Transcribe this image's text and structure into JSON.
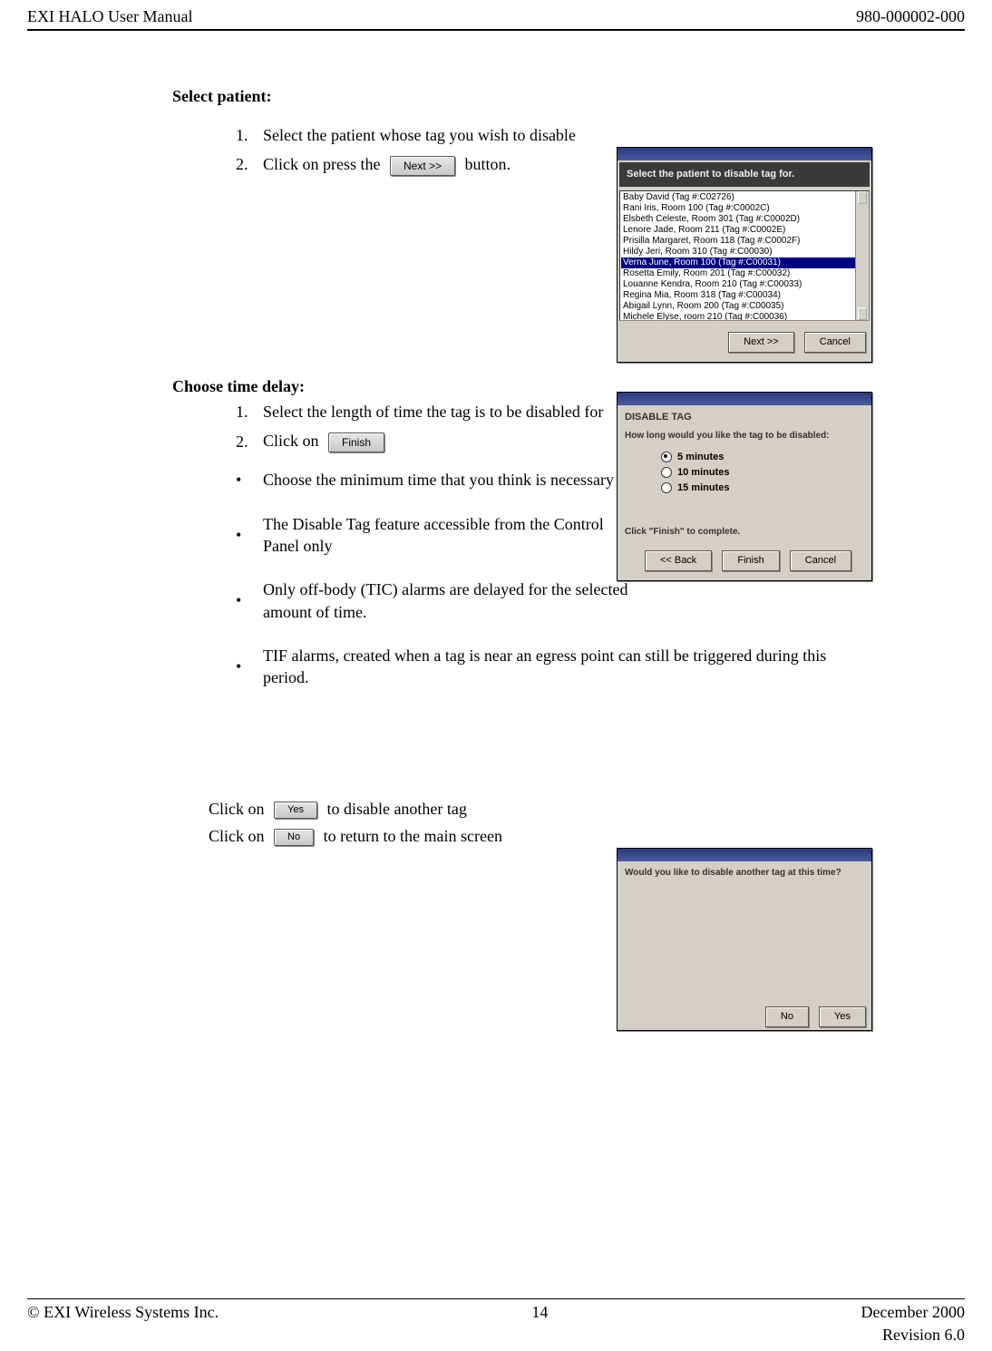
{
  "header": {
    "left": "EXI HALO User Manual",
    "right": "980-000002-000"
  },
  "section1": {
    "title": "Select patient:",
    "item1_num": "1.",
    "item1_text": "Select the patient whose tag you wish to disable",
    "item2_num": "2.",
    "item2_pre": "Click on press the",
    "item2_btn": "Next >>",
    "item2_post": "button."
  },
  "dialog1": {
    "prompt": "Select the patient to disable tag for.",
    "items": [
      "Baby David (Tag #:C02726)",
      "Rani Iris, Room 100 (Tag #:C0002C)",
      "Elsbeth Celeste, Room 301 (Tag #:C0002D)",
      "Lenore Jade, Room 211 (Tag #:C0002E)",
      "Prisilla Margaret, Room 118 (Tag #:C0002F)",
      "Hildy Jeri, Room 310 (Tag #:C00030)",
      "Verna June, Room 100 (Tag #:C00031)",
      "Rosetta Emily, Room 201 (Tag #:C00032)",
      "Louanne Kendra, Room 210 (Tag #:C00033)",
      "Regina Mia, Room 318 (Tag #:C00034)",
      "Abigail Lynn, Room 200 (Tag #:C00035)",
      "Michele Elyse, room 210 (Tag #:C00036)"
    ],
    "selected_index": 6,
    "btn_next": "Next >>",
    "btn_cancel": "Cancel"
  },
  "section2": {
    "title": "Choose time delay:",
    "item1_num": "1.",
    "item1_text": "Select the length of time the tag is to be disabled for",
    "item2_num": "2.",
    "item2_pre": "Click on",
    "item2_btn": "Finish",
    "bullets": [
      "Choose the minimum time that you think is necessary",
      "The Disable Tag feature accessible from the Control Panel only",
      "Only off-body (TIC) alarms are delayed for the selected amount of time.",
      "TIF alarms, created when a tag is near an egress point can still be triggered during this period."
    ]
  },
  "dialog2": {
    "header": "DISABLE TAG",
    "prompt": "How long would you like the tag to be disabled:",
    "opts": [
      "5 minutes",
      "10 minutes",
      "15 minutes"
    ],
    "selected": 0,
    "footer_note": "Click \"Finish\" to complete.",
    "btn_back": "<< Back",
    "btn_finish": "Finish",
    "btn_cancel": "Cancel"
  },
  "section3": {
    "line1_pre": "Click on",
    "line1_btn": "Yes",
    "line1_post": "to disable another tag",
    "line2_pre": "Click on",
    "line2_btn": "No",
    "line2_post": "to return to the main screen"
  },
  "dialog3": {
    "prompt": "Would you like to disable another tag at this time?",
    "btn_no": "No",
    "btn_yes": "Yes"
  },
  "footer": {
    "left": "© EXI Wireless Systems Inc.",
    "center": "14",
    "right1": "December 2000",
    "right2": "Revision 6.0"
  }
}
